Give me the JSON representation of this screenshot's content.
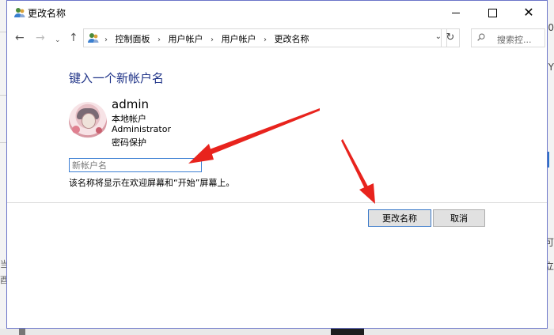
{
  "window": {
    "title": "更改名称",
    "controls": {
      "minimize_icon": "minimize-icon",
      "maximize_icon": "maximize-icon",
      "close_icon": "close-icon",
      "close_glyph": "✕"
    }
  },
  "navigation": {
    "back_glyph": "←",
    "forward_glyph": "→",
    "recent_glyph": "⌄",
    "up_glyph": "↑",
    "breadcrumbs": [
      "控制面板",
      "用户帐户",
      "用户帐户",
      "更改名称"
    ],
    "breadcrumb_separator": "›",
    "address_dropdown_glyph": "⌄",
    "refresh_glyph": "↻",
    "search_placeholder": "搜索控..."
  },
  "content": {
    "heading": "键入一个新帐户名",
    "user": {
      "name": "admin",
      "account_type": "本地帐户",
      "role": "Administrator",
      "protection": "密码保护"
    },
    "new_name_input": {
      "value": "",
      "placeholder": "新帐户名"
    },
    "hint": "该名称将显示在欢迎屏幕和“开始”屏幕上。"
  },
  "buttons": {
    "rename": "更改名称",
    "cancel": "取消"
  },
  "background_fragments": {
    "right_glyphs": [
      "0",
      "Y",
      "可",
      "立"
    ],
    "left_glyphs": [
      "当",
      "酉"
    ]
  },
  "colors": {
    "heading": "#1e3287",
    "input_border": "#3c7fd3",
    "annotation_arrow": "#e8231d",
    "window_border": "#6b75c9"
  }
}
